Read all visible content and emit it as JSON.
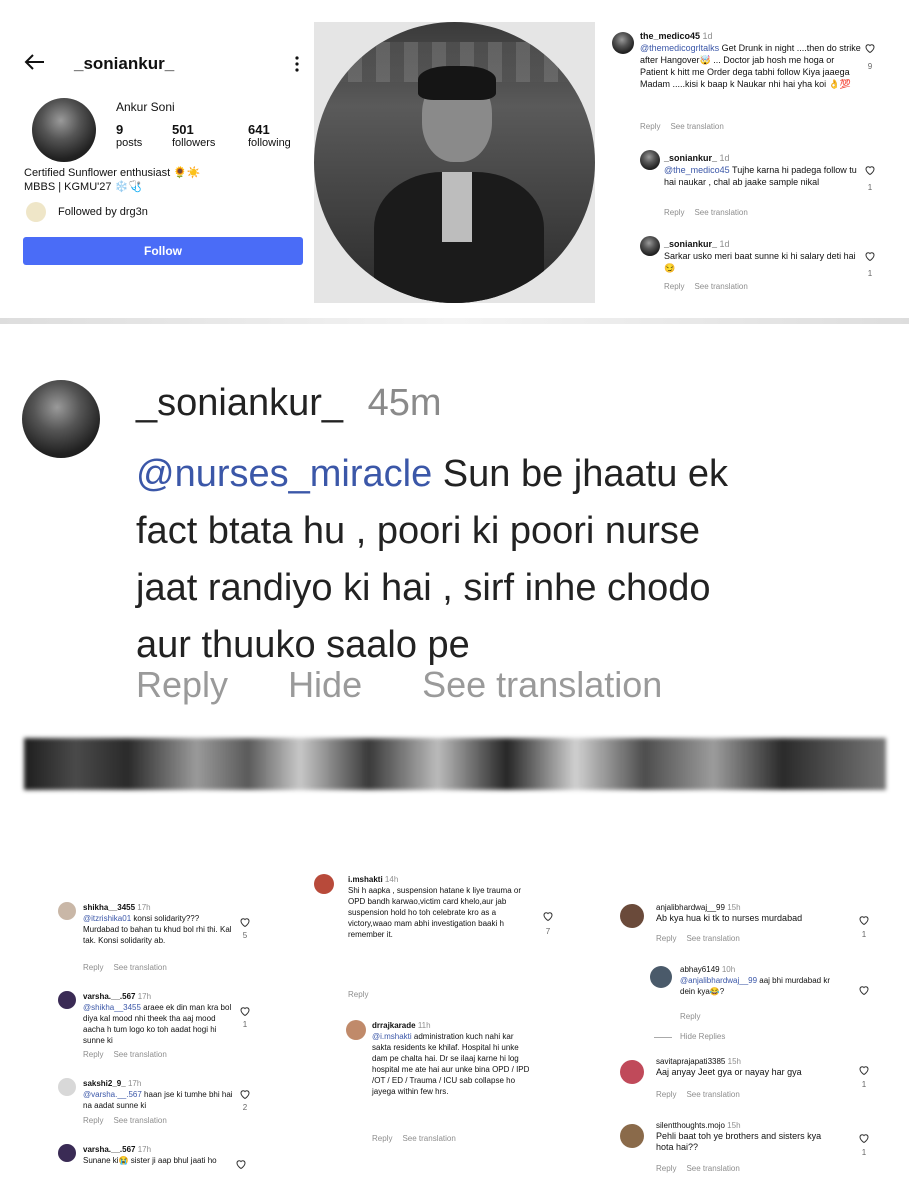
{
  "profile": {
    "username": "_soniankur_",
    "display_name": "Ankur Soni",
    "posts_count": "9",
    "posts_label": "posts",
    "followers_count": "501",
    "followers_label": "followers",
    "following_count": "641",
    "following_label": "following",
    "bio_line1": "Certified Sunflower enthusiast 🌻☀️",
    "bio_line2": "MBBS | KGMU'27 ❄️🩺",
    "followed_by": "Followed by drg3n",
    "follow_button": "Follow"
  },
  "thread_top": {
    "main": {
      "user": "the_medico45",
      "time": "1d",
      "mention": "@themedicogrltalks",
      "text": " Get Drunk in night ....then do strike after Hangover🤯 ... Doctor jab hosh me hoga or Patient k hitt me Order dega tabhi follow Kiya jaaega Madam .....kisi k baap k Naukar nhi hai yha koi 👌💯",
      "likes": "9",
      "reply": "Reply",
      "translate": "See translation"
    },
    "replies": [
      {
        "user": "_soniankur_",
        "time": "1d",
        "mention": "@the_medico45",
        "text": " Tujhe karna hi padega follow tu hai naukar , chal ab jaake sample nikal",
        "likes": "1",
        "reply": "Reply",
        "translate": "See translation"
      },
      {
        "user": "_soniankur_",
        "time": "1d",
        "mention": "",
        "text": "Sarkar usko meri baat sunne ki hi salary deti hai 😏",
        "likes": "1",
        "reply": "Reply",
        "translate": "See translation"
      }
    ]
  },
  "big_comment": {
    "user": "_soniankur_",
    "time": "45m",
    "mention": "@nurses_miracle",
    "line1": " Sun be jhaatu ek",
    "line2": "fact btata hu , poori ki poori nurse",
    "line3": "jaat randiyo ki hai , sirf inhe chodo",
    "line4": "aur thuuko  saalo pe",
    "reply": "Reply",
    "hide": "Hide",
    "translate": "See translation"
  },
  "col1": [
    {
      "user": "shikha__3455",
      "time": "17h",
      "mention": "@itzrishika01",
      "text": " konsi solidarity??? Murdabad to bahan tu khud bol rhi thi. Kal tak. Konsi solidarity ab.",
      "likes": "5",
      "reply": "Reply",
      "translate": "See translation"
    },
    {
      "user": "varsha.__.567",
      "time": "17h",
      "mention": "@shikha__3455",
      "text": " araee ek din man kra bol diya kal mood nhi theek tha aaj mood aacha h tum logo ko toh aadat hogi hi sunne ki",
      "likes": "1",
      "reply": "Reply",
      "translate": "See translation"
    },
    {
      "user": "sakshi2_9_",
      "time": "17h",
      "mention": "@varsha.__.567",
      "text": " haan jse ki tumhe bhi hai na aadat sunne ki",
      "likes": "2",
      "reply": "Reply",
      "translate": "See translation"
    },
    {
      "user": "varsha.__.567",
      "time": "17h",
      "mention": "",
      "text": "Sunane ki😭 sister ji aap bhul jaati ho",
      "likes": "",
      "reply": "",
      "translate": ""
    }
  ],
  "col2": [
    {
      "user": "i.mshakti",
      "time": "14h",
      "mention": "",
      "text": "Shi h aapka , suspension hatane k liye trauma or OPD bandh karwao,victim card khelo,aur jab suspension hold ho toh celebrate kro as a victory,waao mam abhi investigation baaki h remember it.",
      "likes": "7",
      "reply": "Reply",
      "translate": ""
    },
    {
      "user": "drrajkarade",
      "time": "11h",
      "mention": "@i.mshakti",
      "text": " administration kuch nahi kar sakta residents ke khilaf. Hospital hi unke dam pe chalta hai. Dr se ilaaj karne hi log hospital me ate hai aur unke bina OPD / IPD /OT / ED / Trauma / ICU sab collapse ho jayega within few hrs.",
      "likes": "",
      "reply": "Reply",
      "translate": "See translation"
    }
  ],
  "col3": [
    {
      "user": "anjalibhardwaj__99",
      "time": "15h",
      "mention": "",
      "text": "Ab kya hua ki tk to nurses murdabad",
      "likes": "1",
      "reply": "Reply",
      "translate": "See translation"
    },
    {
      "user": "abhay6149",
      "time": "10h",
      "mention": "@anjalibhardwaj__99",
      "text": " aaj bhi murdabad kr dein kya😂?",
      "likes": "",
      "reply": "Reply",
      "translate": "",
      "hide_replies": "Hide Replies"
    },
    {
      "user": "savitaprajapati3385",
      "time": "15h",
      "mention": "",
      "text": "Aaj anyay Jeet gya or nayay har gya",
      "likes": "1",
      "reply": "Reply",
      "translate": "See translation"
    },
    {
      "user": "silentthoughts.mojo",
      "time": "15h",
      "mention": "",
      "text": "Pehli baat toh ye brothers and sisters kya hota hai??",
      "likes": "1",
      "reply": "Reply",
      "translate": "See translation"
    }
  ],
  "colors": {
    "primary_button": "#4a6cf7",
    "mention": "#3b57a8",
    "meta": "#8e8e8e"
  },
  "icons": [
    "back-arrow-icon",
    "more-vertical-icon",
    "heart-icon"
  ]
}
